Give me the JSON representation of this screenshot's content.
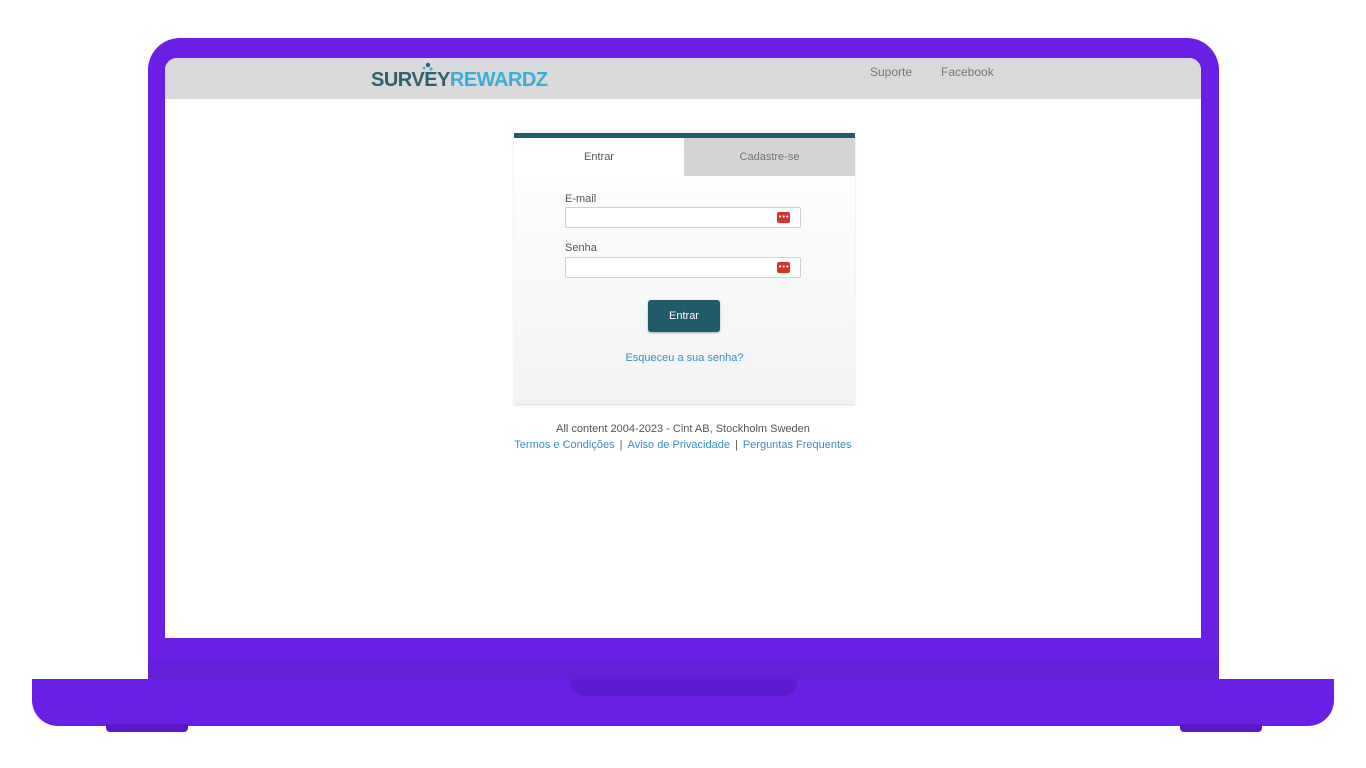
{
  "header": {
    "logo_part1": "SURVEY",
    "logo_part2": "REWARDZ",
    "nav": [
      "Suporte",
      "Facebook"
    ]
  },
  "login": {
    "tabs": [
      {
        "label": "Entrar",
        "active": true
      },
      {
        "label": "Cadastre-se",
        "active": false
      }
    ],
    "email_label": "E-mail",
    "email_value": "",
    "password_label": "Senha",
    "password_value": "",
    "submit_label": "Entrar",
    "forgot_label": "Esqueceu a sua senha?"
  },
  "footer": {
    "copyright": "All content 2004-2023 - Cint AB, Stockholm Sweden",
    "links": [
      "Termos e Condições",
      "Aviso de Privacidade",
      "Perguntas Frequentes"
    ],
    "separator": "|"
  },
  "icons": {
    "password_manager": "password-manager-icon"
  },
  "colors": {
    "frame": "#6a1fe4",
    "primary": "#215a68",
    "link": "#3a8ec0",
    "logo_dark": "#2f6170",
    "logo_light": "#3aaed8",
    "password_icon": "#d8322c"
  }
}
